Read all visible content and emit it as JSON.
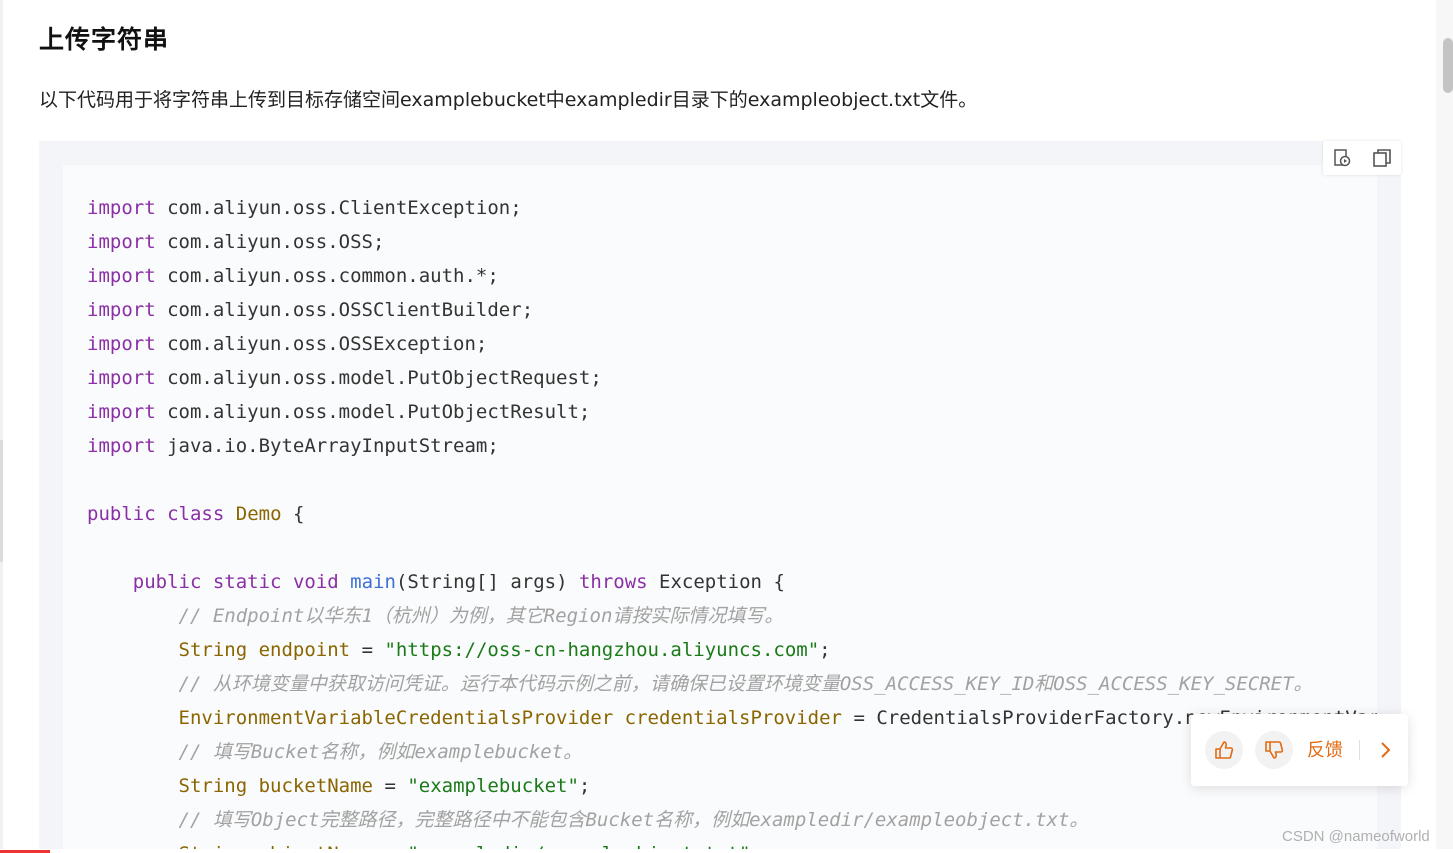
{
  "section": {
    "title": "上传字符串",
    "description": "以下代码用于将字符串上传到目标存储空间examplebucket中exampledir目录下的exampleobject.txt文件。"
  },
  "code": {
    "lines": [
      [
        {
          "t": "import",
          "c": "kw"
        },
        {
          "t": " com.aliyun.oss.ClientException;"
        }
      ],
      [
        {
          "t": "import",
          "c": "kw"
        },
        {
          "t": " com.aliyun.oss.OSS;"
        }
      ],
      [
        {
          "t": "import",
          "c": "kw"
        },
        {
          "t": " com.aliyun.oss.common.auth.*;"
        }
      ],
      [
        {
          "t": "import",
          "c": "kw"
        },
        {
          "t": " com.aliyun.oss.OSSClientBuilder;"
        }
      ],
      [
        {
          "t": "import",
          "c": "kw"
        },
        {
          "t": " com.aliyun.oss.OSSException;"
        }
      ],
      [
        {
          "t": "import",
          "c": "kw"
        },
        {
          "t": " com.aliyun.oss.model.PutObjectRequest;"
        }
      ],
      [
        {
          "t": "import",
          "c": "kw"
        },
        {
          "t": " com.aliyun.oss.model.PutObjectResult;"
        }
      ],
      [
        {
          "t": "import",
          "c": "kw"
        },
        {
          "t": " java.io.ByteArrayInputStream;"
        }
      ],
      [],
      [
        {
          "t": "public",
          "c": "kw"
        },
        {
          "t": " "
        },
        {
          "t": "class",
          "c": "kw"
        },
        {
          "t": " "
        },
        {
          "t": "Demo",
          "c": "ty"
        },
        {
          "t": " {"
        }
      ],
      [],
      [
        {
          "t": "    "
        },
        {
          "t": "public",
          "c": "kw"
        },
        {
          "t": " "
        },
        {
          "t": "static",
          "c": "kw"
        },
        {
          "t": " "
        },
        {
          "t": "void",
          "c": "kw"
        },
        {
          "t": " "
        },
        {
          "t": "main",
          "c": "fn"
        },
        {
          "t": "(String[] args) "
        },
        {
          "t": "throws",
          "c": "kw"
        },
        {
          "t": " Exception {"
        }
      ],
      [
        {
          "t": "        "
        },
        {
          "t": "// Endpoint以华东1（杭州）为例，其它Region请按实际情况填写。",
          "c": "cm"
        }
      ],
      [
        {
          "t": "        "
        },
        {
          "t": "String",
          "c": "ty"
        },
        {
          "t": " "
        },
        {
          "t": "endpoint",
          "c": "ty"
        },
        {
          "t": " = "
        },
        {
          "t": "\"https://oss-cn-hangzhou.aliyuncs.com\"",
          "c": "st"
        },
        {
          "t": ";"
        }
      ],
      [
        {
          "t": "        "
        },
        {
          "t": "// 从环境变量中获取访问凭证。运行本代码示例之前，请确保已设置环境变量OSS_ACCESS_KEY_ID和OSS_ACCESS_KEY_SECRET。",
          "c": "cm"
        }
      ],
      [
        {
          "t": "        "
        },
        {
          "t": "EnvironmentVariableCredentialsProvider",
          "c": "ty"
        },
        {
          "t": " "
        },
        {
          "t": "credentialsProvider",
          "c": "ty"
        },
        {
          "t": " = CredentialsProviderFactory.newEnvironmentVariableCredentialsProvider();"
        }
      ],
      [
        {
          "t": "        "
        },
        {
          "t": "// 填写Bucket名称，例如examplebucket。",
          "c": "cm"
        }
      ],
      [
        {
          "t": "        "
        },
        {
          "t": "String",
          "c": "ty"
        },
        {
          "t": " "
        },
        {
          "t": "bucketName",
          "c": "ty"
        },
        {
          "t": " = "
        },
        {
          "t": "\"examplebucket\"",
          "c": "st"
        },
        {
          "t": ";"
        }
      ],
      [
        {
          "t": "        "
        },
        {
          "t": "// 填写Object完整路径，完整路径中不能包含Bucket名称，例如exampledir/exampleobject.txt。",
          "c": "cm"
        }
      ],
      [
        {
          "t": "        "
        },
        {
          "t": "String",
          "c": "ty"
        },
        {
          "t": " "
        },
        {
          "t": "objectName",
          "c": "ty"
        },
        {
          "t": " = "
        },
        {
          "t": "\"exampledir/exampleobject.txt\"",
          "c": "st"
        },
        {
          "t": ";"
        }
      ]
    ]
  },
  "toolbar": {
    "icons": [
      "run-icon",
      "copy-icon"
    ]
  },
  "feedback": {
    "label": "反馈",
    "accent": "#e26a12",
    "icons": [
      "thumbs-up-icon",
      "thumbs-down-icon",
      "chevron-right-icon"
    ]
  },
  "watermark": "CSDN @nameofworld"
}
